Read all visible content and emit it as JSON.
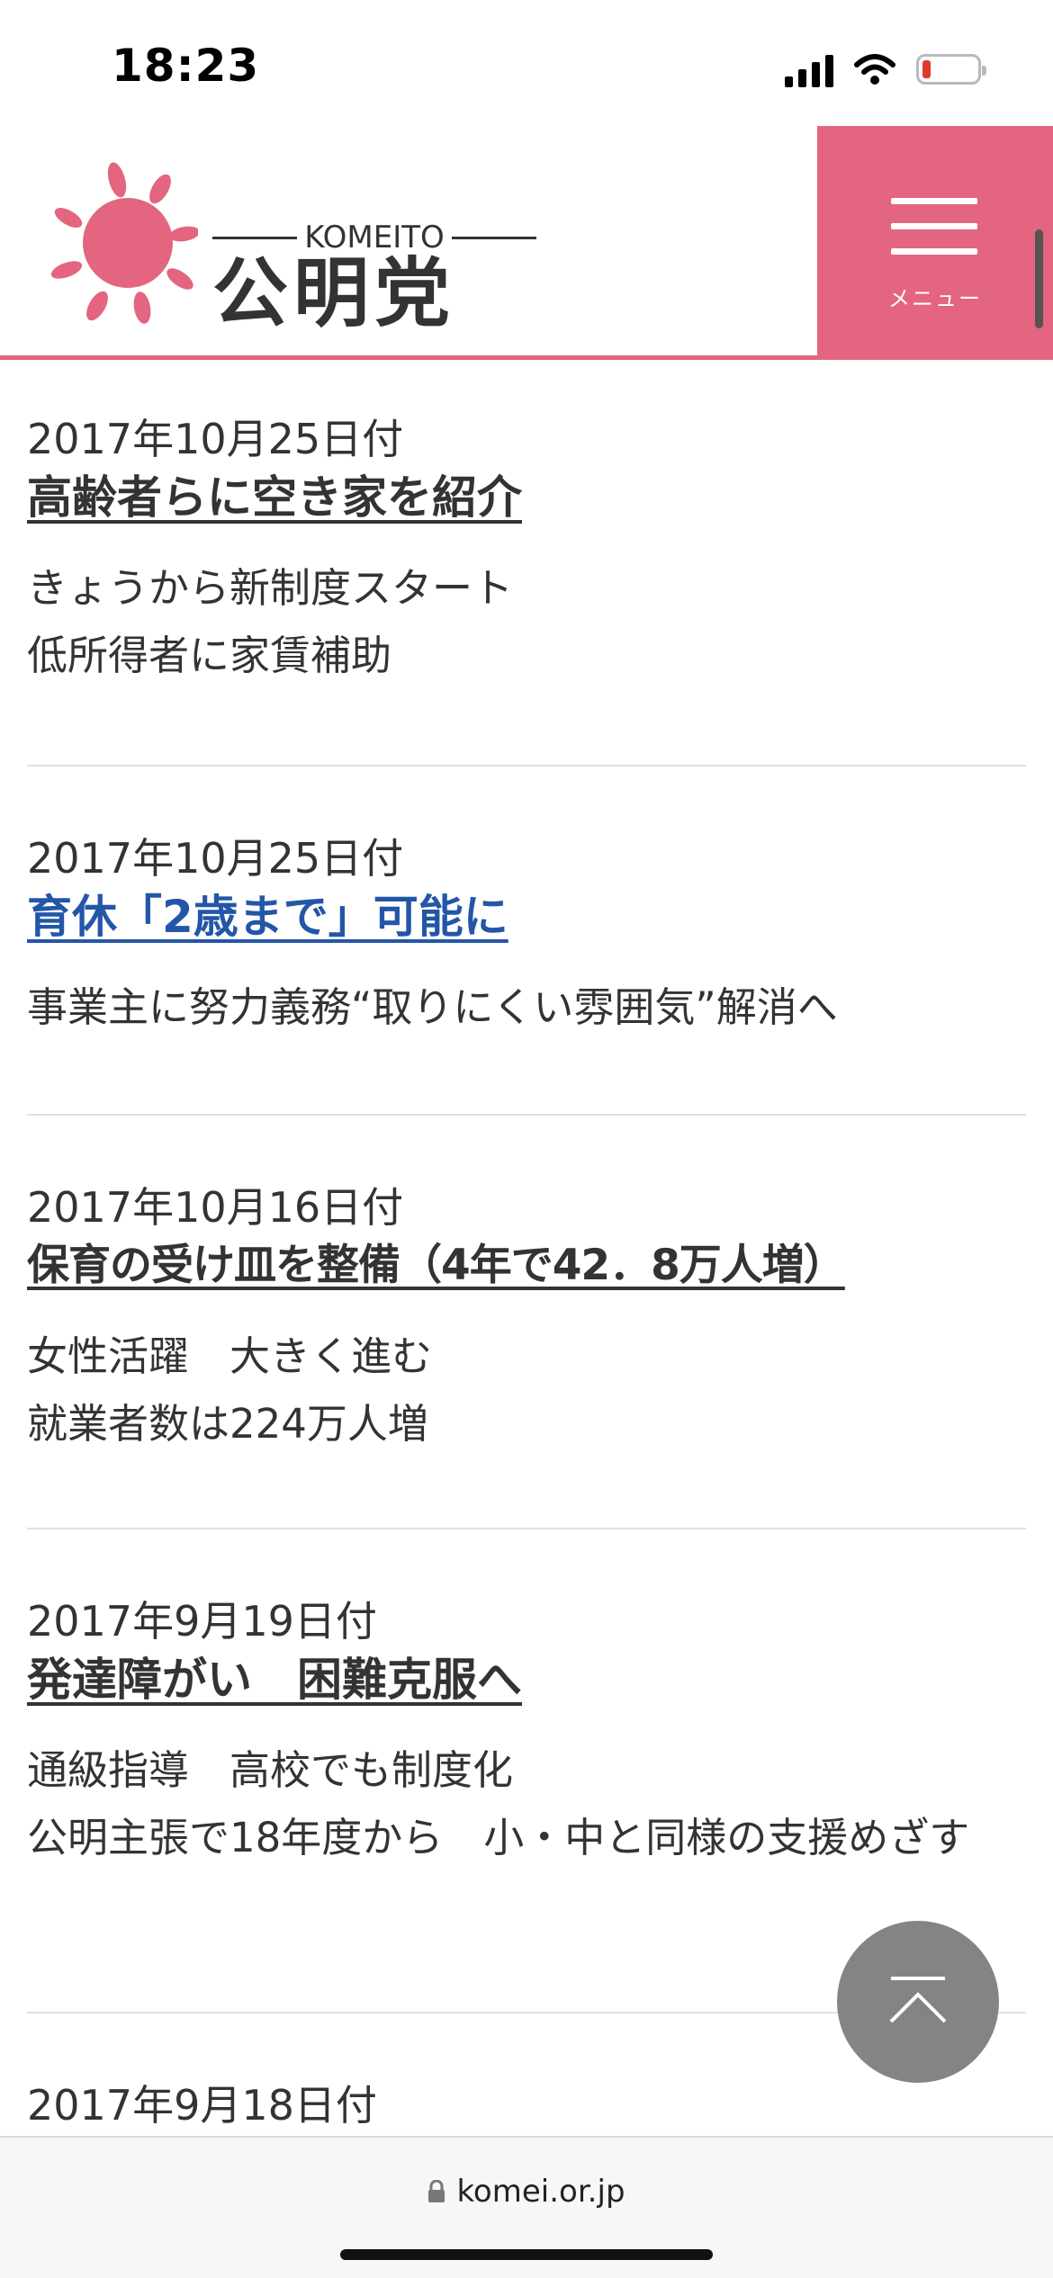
{
  "status_bar": {
    "time": "18:23",
    "battery_level": 0.1,
    "battery_color": "#e03a2e"
  },
  "header": {
    "logo_en": "KOMEITO",
    "logo_jp": "公明党",
    "menu_label": "メニュー",
    "accent_color": "#e3657f"
  },
  "news": [
    {
      "date": "2017年10月25日付",
      "title": "高齢者らに空き家を紹介",
      "summary": [
        "きょうから新制度スタート",
        "低所得者に家賃補助"
      ],
      "visited": false
    },
    {
      "date": "2017年10月25日付",
      "title": "育休「2歳まで」可能に",
      "summary": [
        "事業主に努力義務“取りにくい雰囲気”解消へ"
      ],
      "visited": true
    },
    {
      "date": "2017年10月16日付",
      "title": "保育の受け皿を整備（4年で42．8万人増）",
      "summary": [
        "女性活躍　大きく進む",
        "就業者数は224万人増"
      ],
      "visited": false
    },
    {
      "date": "2017年9月19日付",
      "title": "発達障がい　困難克服へ",
      "summary": [
        "通級指導　高校でも制度化",
        "公明主張で18年度から　小・中と同様の支援めざす"
      ],
      "visited": false
    },
    {
      "date": "2017年9月18日付"
    }
  ],
  "back_to_top": {
    "icon": "chevron-up-icon"
  },
  "browser": {
    "url": "komei.or.jp",
    "lock_icon": "lock-icon"
  }
}
